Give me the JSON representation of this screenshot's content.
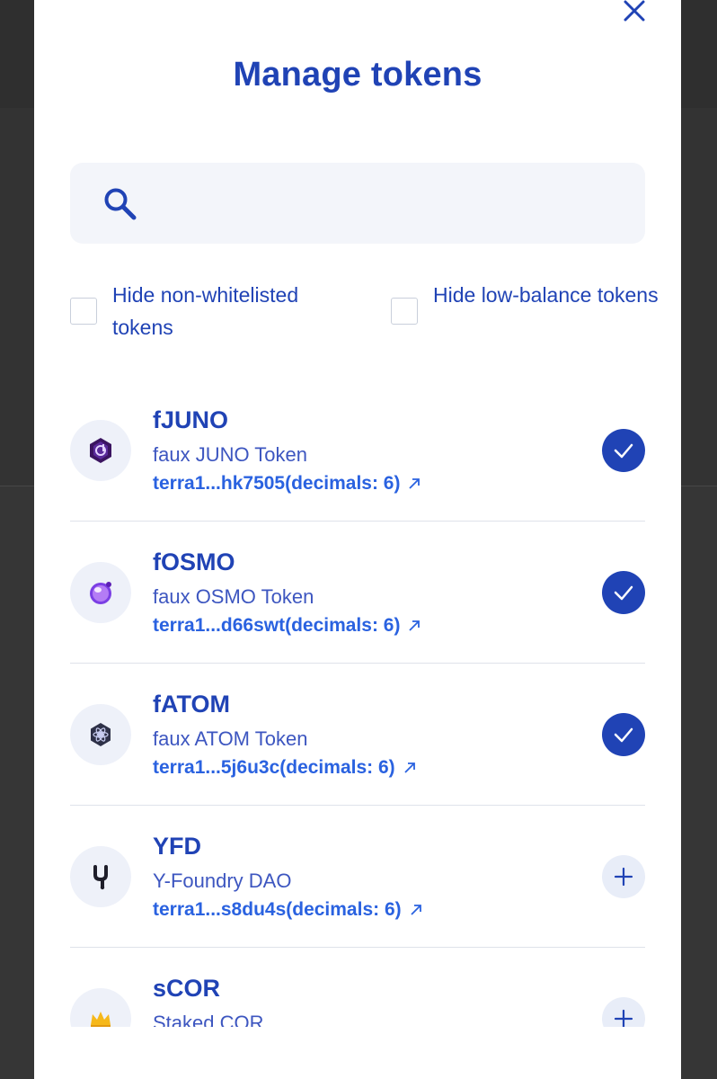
{
  "modal": {
    "title": "Manage tokens",
    "close_icon": "close-icon"
  },
  "search": {
    "placeholder": "",
    "value": "",
    "icon": "search-icon"
  },
  "filters": [
    {
      "label": "Hide non-whitelisted tokens",
      "checked": false
    },
    {
      "label": "Hide low-balance tokens",
      "checked": false
    }
  ],
  "tokens": [
    {
      "symbol": "fJUNO",
      "name": "faux JUNO Token",
      "address": "terra1...hk7505(decimals: 6)",
      "added": true,
      "icon": "juno-logo"
    },
    {
      "symbol": "fOSMO",
      "name": "faux OSMO Token",
      "address": "terra1...d66swt(decimals: 6)",
      "added": true,
      "icon": "osmo-logo"
    },
    {
      "symbol": "fATOM",
      "name": "faux ATOM Token",
      "address": "terra1...5j6u3c(decimals: 6)",
      "added": true,
      "icon": "atom-logo"
    },
    {
      "symbol": "YFD",
      "name": "Y-Foundry DAO",
      "address": "terra1...s8du4s(decimals: 6)",
      "added": false,
      "icon": "yfd-logo"
    },
    {
      "symbol": "sCOR",
      "name": "Staked COR",
      "address": "",
      "added": false,
      "icon": "cor-logo"
    }
  ],
  "colors": {
    "primary": "#2043b5",
    "link": "#2a62e0",
    "search_bg": "#f3f5fa",
    "toggle_off_bg": "#e8edf8"
  }
}
